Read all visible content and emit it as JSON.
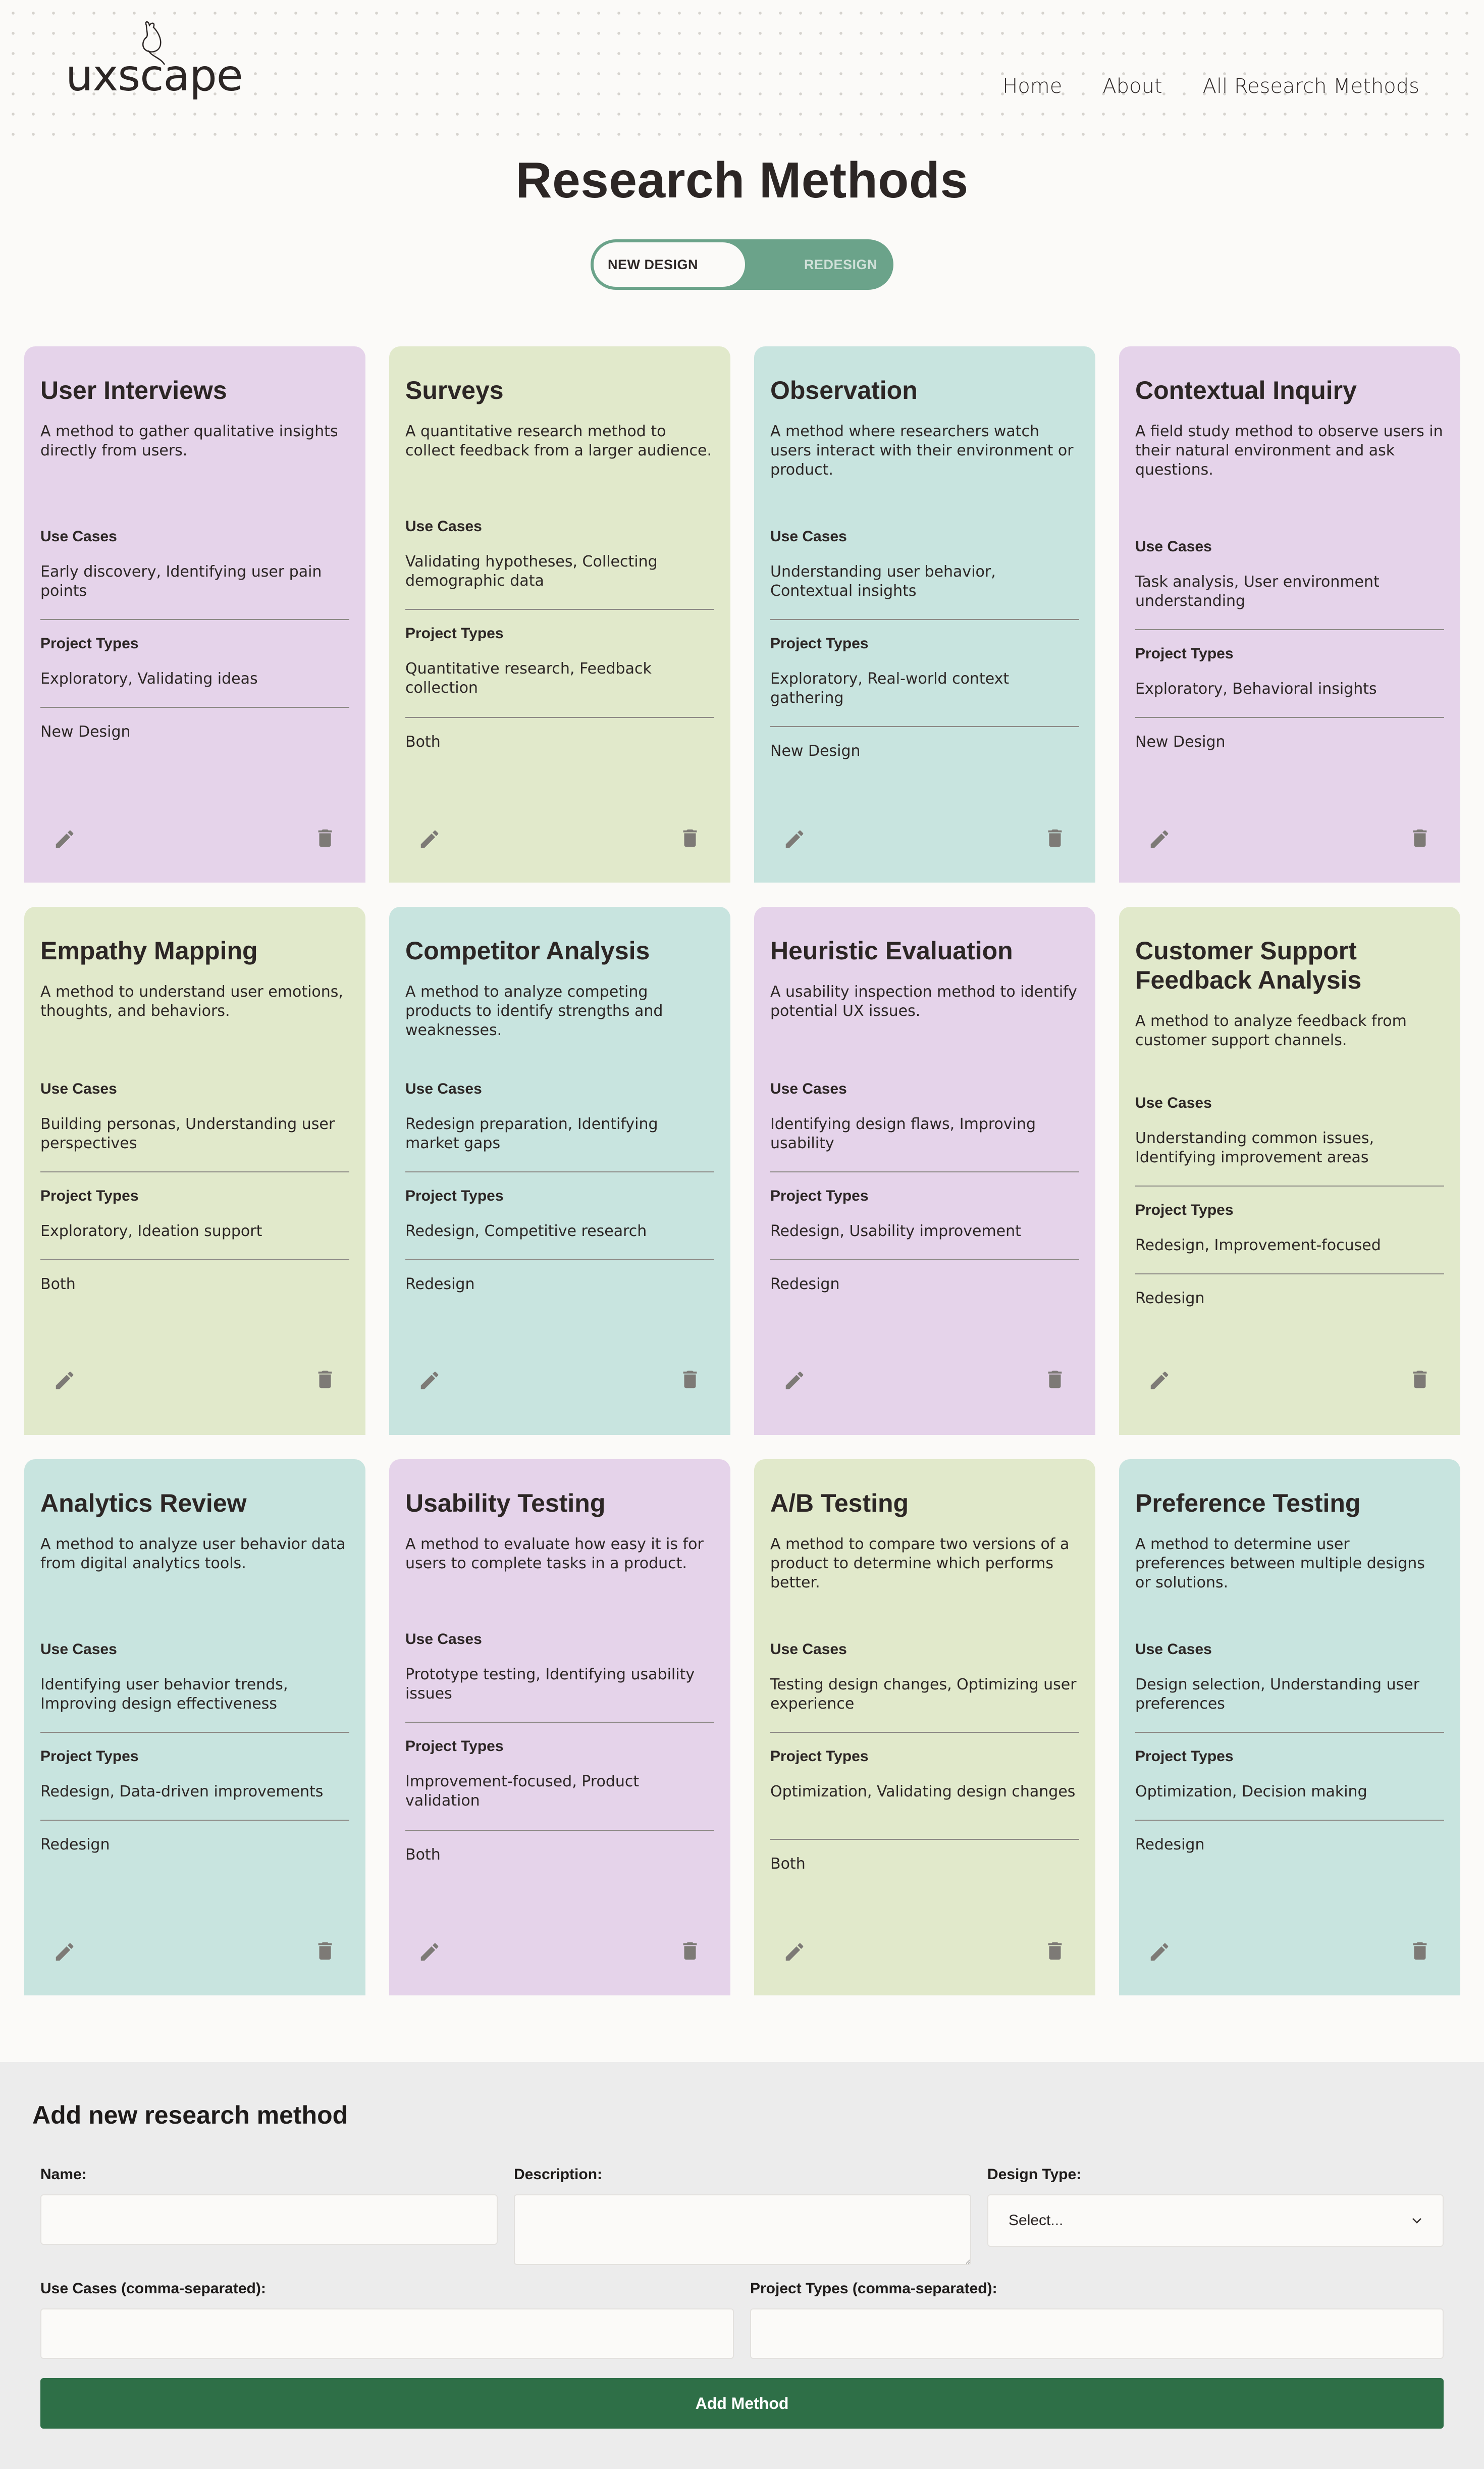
{
  "header": {
    "logo": "uxscape",
    "nav": [
      "Home",
      "About",
      "All Research Methods"
    ]
  },
  "page_title": "Research Methods",
  "toggle": {
    "new_design": "NEW DESIGN",
    "redesign": "REDESIGN",
    "active": "NEW DESIGN"
  },
  "labels": {
    "use_cases": "Use Cases",
    "project_types": "Project Types"
  },
  "colors": {
    "lilac": "#e5d3ea",
    "lime": "#e1e9cb",
    "teal": "#c8e4df",
    "button": "#2e6f47",
    "toggle": "#6ba38a"
  },
  "cards": [
    {
      "title": "User Interviews",
      "description": "A method to gather qualitative insights directly from users.",
      "use_cases": "Early discovery, Identifying user pain points",
      "project_types": "Exploratory, Validating ideas",
      "design": "New Design",
      "color": "lilac"
    },
    {
      "title": "Surveys",
      "description": "A quantitative research method to collect feedback from a larger audience.",
      "use_cases": "Validating hypotheses, Collecting demographic data",
      "project_types": "Quantitative research, Feedback collection",
      "design": "Both",
      "color": "lime"
    },
    {
      "title": "Observation",
      "description": "A method where researchers watch users interact with their environment or product.",
      "use_cases": "Understanding user behavior, Contextual insights",
      "project_types": "Exploratory, Real-world context gathering",
      "design": "New Design",
      "color": "teal"
    },
    {
      "title": "Contextual Inquiry",
      "description": "A field study method to observe users in their natural environment and ask questions.",
      "use_cases": "Task analysis, User environment understanding",
      "project_types": "Exploratory, Behavioral insights",
      "design": "New Design",
      "color": "lilac"
    },
    {
      "title": "Empathy Mapping",
      "description": "A method to understand user emotions, thoughts, and behaviors.",
      "use_cases": "Building personas, Understanding user perspectives",
      "project_types": "Exploratory, Ideation support",
      "design": "Both",
      "color": "lime"
    },
    {
      "title": "Competitor Analysis",
      "description": "A method to analyze competing products to identify strengths and weaknesses.",
      "use_cases": "Redesign preparation, Identifying market gaps",
      "project_types": "Redesign, Competitive research",
      "design": "Redesign",
      "color": "teal"
    },
    {
      "title": "Heuristic Evaluation",
      "description": "A usability inspection method to identify potential UX issues.",
      "use_cases": "Identifying design flaws, Improving usability",
      "project_types": "Redesign, Usability improvement",
      "design": "Redesign",
      "color": "lilac"
    },
    {
      "title": "Customer Support Feedback Analysis",
      "description": "A method to analyze feedback from customer support channels.",
      "use_cases": "Understanding common issues, Identifying improvement areas",
      "project_types": "Redesign, Improvement-focused",
      "design": "Redesign",
      "color": "lime"
    },
    {
      "title": "Analytics Review",
      "description": "A method to analyze user behavior data from digital analytics tools.",
      "use_cases": "Identifying user behavior trends, Improving design effectiveness",
      "project_types": "Redesign, Data-driven improvements",
      "design": "Redesign",
      "color": "teal"
    },
    {
      "title": "Usability Testing",
      "description": "A method to evaluate how easy it is for users to complete tasks in a product.",
      "use_cases": "Prototype testing, Identifying usability issues",
      "project_types": "Improvement-focused, Product validation",
      "design": "Both",
      "color": "lilac"
    },
    {
      "title": "A/B Testing",
      "description": "A method to compare two versions of a product to determine which performs better.",
      "use_cases": "Testing design changes, Optimizing user experience",
      "project_types": "Optimization, Validating design changes",
      "design": "Both",
      "color": "lime"
    },
    {
      "title": "Preference Testing",
      "description": "A method to determine user preferences between multiple designs or solutions.",
      "use_cases": "Design selection, Understanding user preferences",
      "project_types": "Optimization, Decision making",
      "design": "Redesign",
      "color": "teal"
    }
  ],
  "form": {
    "title": "Add new research method",
    "name_label": "Name:",
    "description_label": "Description:",
    "design_type_label": "Design Type:",
    "design_type_value": "Select...",
    "use_cases_label": "Use Cases (comma-separated):",
    "project_types_label": "Project Types (comma-separated):",
    "name_value": "",
    "description_value": "",
    "use_cases_value": "",
    "project_types_value": "",
    "submit_label": "Add Method"
  }
}
